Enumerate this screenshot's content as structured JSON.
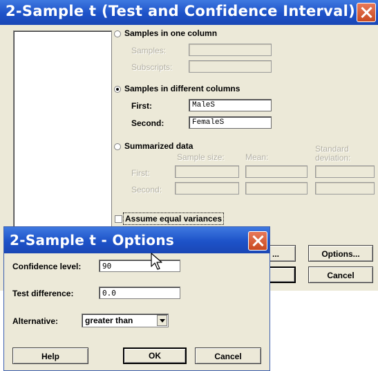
{
  "main_dialog": {
    "title": "2-Sample t (Test and Confidence Interval)",
    "one_column": {
      "option_label": "Samples in one column",
      "samples_label": "Samples:",
      "subscripts_label": "Subscripts:",
      "samples_value": "",
      "subscripts_value": "",
      "selected": false
    },
    "different_columns": {
      "option_label": "Samples in different columns",
      "first_label": "First:",
      "first_value": "MaleS",
      "second_label": "Second:",
      "second_value": "FemaleS",
      "selected": true
    },
    "summarized": {
      "option_label": "Summarized data",
      "sample_size_header": "Sample size:",
      "mean_header": "Mean:",
      "stddev_header_line1": "Standard",
      "stddev_header_line2": "deviation:",
      "first_label": "First:",
      "second_label": "Second:",
      "selected": false
    },
    "assume_equal_variances": {
      "label": "Assume equal variances",
      "checked": false
    },
    "buttons": {
      "graphs_label": "...",
      "options_label": "Options...",
      "ok_label": "",
      "cancel_label": "Cancel"
    }
  },
  "options_dialog": {
    "title": "2-Sample t - Options",
    "confidence_level_label": "Confidence level:",
    "confidence_level_value": "90",
    "test_difference_label": "Test difference:",
    "test_difference_value": "0.0",
    "alternative_label": "Alternative:",
    "alternative_value": "greater than",
    "buttons": {
      "help_label": "Help",
      "ok_label": "OK",
      "cancel_label": "Cancel"
    }
  },
  "colors": {
    "titlebar": "#1d52c8",
    "dialog_bg": "#ece9d8",
    "close_button": "#d85a30",
    "disabled_text": "#b4b1a4"
  },
  "icons": [
    "close-icon",
    "dropdown-arrow-icon",
    "mouse-pointer-icon"
  ]
}
